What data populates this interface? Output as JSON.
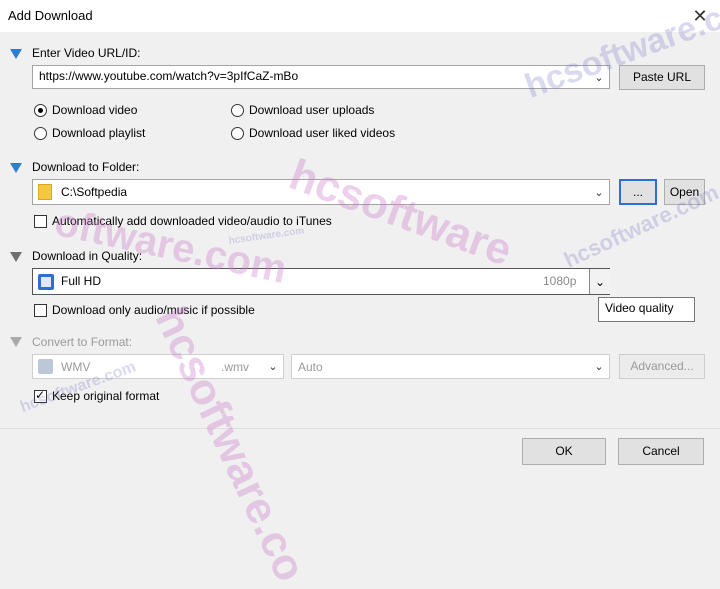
{
  "window": {
    "title": "Add Download",
    "close_icon": "close-icon"
  },
  "url_section": {
    "label": "Enter Video URL/ID:",
    "value": "https://www.youtube.com/watch?v=3pIfCaZ-mBo",
    "paste_label": "Paste URL",
    "options": [
      {
        "label": "Download video",
        "selected": true
      },
      {
        "label": "Download user uploads",
        "selected": false
      },
      {
        "label": "Download playlist",
        "selected": false
      },
      {
        "label": "Download user liked videos",
        "selected": false
      }
    ]
  },
  "folder_section": {
    "label": "Download to Folder:",
    "value": "C:\\Softpedia",
    "browse_label": "...",
    "open_label": "Open",
    "itunes_label": "Automatically add downloaded video/audio to iTunes",
    "itunes_checked": false
  },
  "quality_section": {
    "label": "Download in Quality:",
    "value": "Full HD",
    "resolution": "1080p",
    "tooltip": "Video quality",
    "audio_only_label": "Download only audio/music if possible",
    "audio_only_checked": false
  },
  "convert_section": {
    "label": "Convert to Format:",
    "format": "WMV",
    "extension": ".wmv",
    "preset": "Auto",
    "advanced_label": "Advanced...",
    "keep_label": "Keep original format",
    "keep_checked": true
  },
  "footer": {
    "ok_label": "OK",
    "cancel_label": "Cancel"
  },
  "watermark": {
    "brand": "hcsoftware.com",
    "brand_partial_1": "hcsoftware",
    "brand_partial_2": "oftware.com",
    "brand_partial_3": "hcsoftware.co"
  },
  "colors": {
    "accent": "#2a7fd4",
    "focus_border": "#2f6fd4"
  }
}
